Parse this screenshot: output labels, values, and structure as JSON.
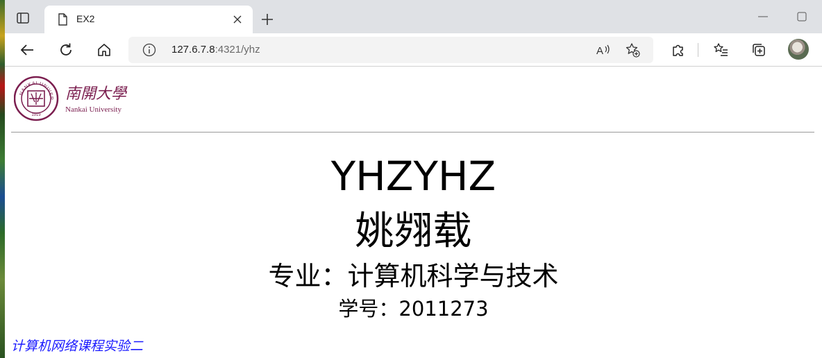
{
  "browser": {
    "tab_title": "EX2",
    "url_host": "127.6.7.8",
    "url_rest": ":4321/yhz"
  },
  "logo": {
    "cn_name": "南開大學",
    "en_name": "Nankai University",
    "seal_ring_text": "NANKAI UNIVERSITY",
    "seal_year": "1919"
  },
  "content": {
    "title": "YHZYHZ",
    "name": "姚翙载",
    "major": "专业：计算机科学与技术",
    "student_id": "学号：2011273",
    "footer_link": "计算机网络课程实验二"
  },
  "colors": {
    "brand": "#7b1e4f",
    "link": "#1a1aff"
  }
}
